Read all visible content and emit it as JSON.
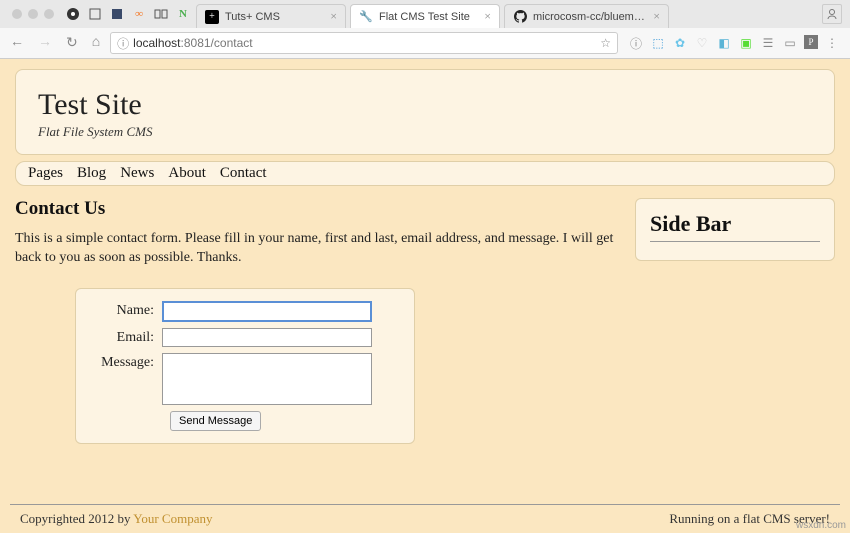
{
  "browser": {
    "tabs": [
      {
        "title": "Tuts+ CMS",
        "favicon": "plus"
      },
      {
        "title": "Flat CMS Test Site",
        "favicon": "wrench"
      },
      {
        "title": "microcosm-cc/bluemonday: b",
        "favicon": "github"
      }
    ],
    "url_host": "localhost",
    "url_port_path": ":8081/contact"
  },
  "site": {
    "title": "Test Site",
    "subtitle": "Flat File System CMS",
    "nav": [
      "Pages",
      "Blog",
      "News",
      "About",
      "Contact"
    ]
  },
  "content": {
    "heading": "Contact Us",
    "description": "This is a simple contact form. Please fill in your name, first and last, email address, and message. I will get back to you as soon as possible. Thanks.",
    "form": {
      "name_label": "Name:",
      "email_label": "Email:",
      "message_label": "Message:",
      "submit_label": "Send Message",
      "name_value": "",
      "email_value": "",
      "message_value": ""
    }
  },
  "sidebar": {
    "title": "Side Bar"
  },
  "footer": {
    "left_prefix": "Copyrighted 2012 by ",
    "company": "Your Company",
    "right": "Running on a flat CMS server!"
  },
  "watermark": "wsxdn.com"
}
